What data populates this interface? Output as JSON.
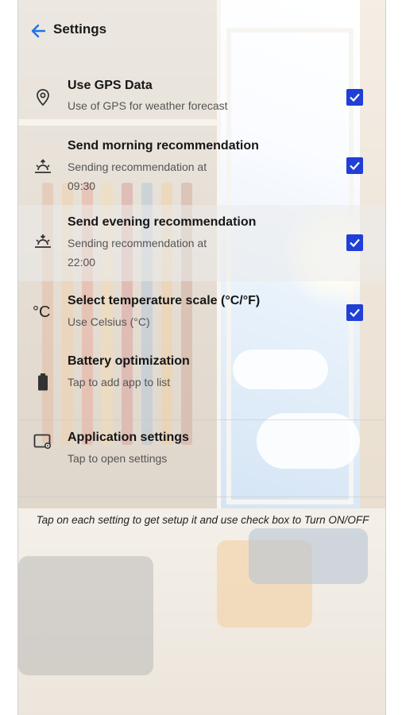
{
  "header": {
    "title": "Settings",
    "back_icon": "arrow-back-icon"
  },
  "accent_color": "#1f3fd6",
  "settings": [
    {
      "title": "Use GPS Data",
      "subtitle": "Use of GPS for weather forecast",
      "icon": "location-pin-icon",
      "checked": true
    },
    {
      "title": "Send morning recommendation",
      "subtitle": "Sending recommendation at",
      "time": "09:30",
      "icon": "sunrise-icon",
      "checked": true
    },
    {
      "title": "Send evening recommendation",
      "subtitle": "Sending recommendation at",
      "time": "22:00",
      "icon": "sunset-icon",
      "checked": true
    },
    {
      "title": "Select temperature scale (°C/°F)",
      "subtitle": "Use Celsius (°C)",
      "icon": "celsius-icon",
      "icon_text": "°C",
      "checked": true
    },
    {
      "title": "Battery optimization",
      "subtitle": "Tap to add app to list",
      "icon": "battery-icon"
    },
    {
      "title": "Application settings",
      "subtitle": "Tap to open settings",
      "icon": "app-settings-icon"
    }
  ],
  "footer": {
    "hint": "Tap on each setting to get setup it and use check box to Turn ON/OFF"
  }
}
